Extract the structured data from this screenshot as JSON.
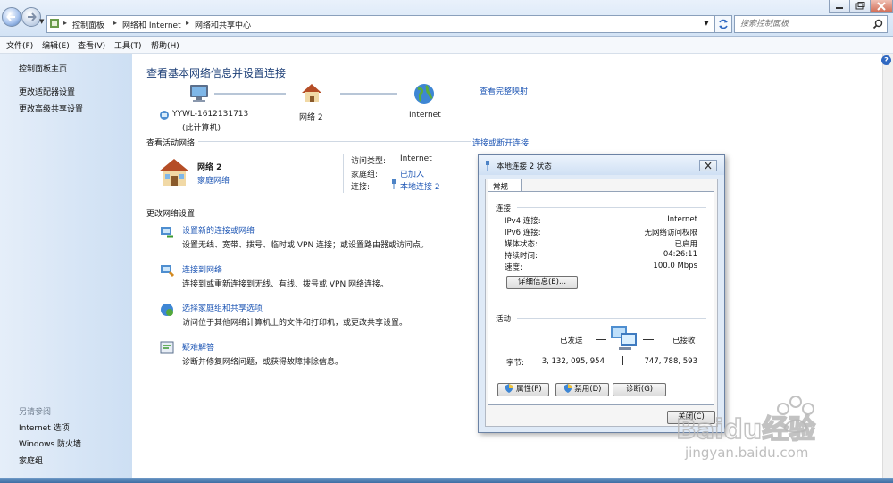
{
  "address": {
    "crumbs": [
      "控制面板",
      "网络和 Internet",
      "网络和共享中心"
    ],
    "search_placeholder": "搜索控制面板"
  },
  "menu": [
    "文件(F)",
    "编辑(E)",
    "查看(V)",
    "工具(T)",
    "帮助(H)"
  ],
  "sidebar": {
    "top_links": [
      "控制面板主页",
      "更改适配器设置",
      "更改高级共享设置"
    ],
    "see_also_title": "另请参阅",
    "see_also": [
      "Internet 选项",
      "Windows 防火墙",
      "家庭组"
    ]
  },
  "main": {
    "title": "查看基本网络信息并设置连接",
    "map_link": "查看完整映射",
    "computer_name": "YYWL-1612131713",
    "computer_sub": "(此计算机)",
    "network_node": "网络  2",
    "internet_node": "Internet",
    "active_title": "查看活动网络",
    "connect_link": "连接或断开连接",
    "network_name": "网络  2",
    "network_type": "家庭网络",
    "access_label": "访问类型:",
    "access_value": "Internet",
    "homegroup_label": "家庭组:",
    "homegroup_value": "已加入",
    "conn_label": "连接:",
    "conn_value": "本地连接 2",
    "change_title": "更改网络设置",
    "tasks": [
      {
        "title": "设置新的连接或网络",
        "desc": "设置无线、宽带、拨号、临时或 VPN 连接；或设置路由器或访问点。"
      },
      {
        "title": "连接到网络",
        "desc": "连接到或重新连接到无线、有线、拨号或 VPN 网络连接。"
      },
      {
        "title": "选择家庭组和共享选项",
        "desc": "访问位于其他网络计算机上的文件和打印机，或更改共享设置。"
      },
      {
        "title": "疑难解答",
        "desc": "诊断并修复网络问题，或获得故障排除信息。"
      }
    ]
  },
  "dialog": {
    "title": "本地连接 2 状态",
    "tab": "常规",
    "conn_section": "连接",
    "rows": [
      {
        "label": "IPv4 连接:",
        "value": "Internet"
      },
      {
        "label": "IPv6 连接:",
        "value": "无网络访问权限"
      },
      {
        "label": "媒体状态:",
        "value": "已启用"
      },
      {
        "label": "持续时间:",
        "value": "04:26:11"
      },
      {
        "label": "速度:",
        "value": "100.0 Mbps"
      }
    ],
    "details_btn": "详细信息(E)...",
    "activity_section": "活动",
    "sent_label": "已发送",
    "recv_label": "已接收",
    "bytes_label": "字节:",
    "bytes_sent": "3, 132, 095, 954",
    "bytes_recv": "747, 788, 593",
    "props_btn": "属性(P)",
    "disable_btn": "禁用(D)",
    "diagnose_btn": "诊断(G)",
    "close_btn": "关闭(C)"
  },
  "watermark": {
    "brand": "Baidu经验",
    "url": "jingyan.baidu.com"
  },
  "colors": {
    "link": "#1f57b5",
    "title": "#1d3f77",
    "sidebar": "#dbe7f5"
  }
}
